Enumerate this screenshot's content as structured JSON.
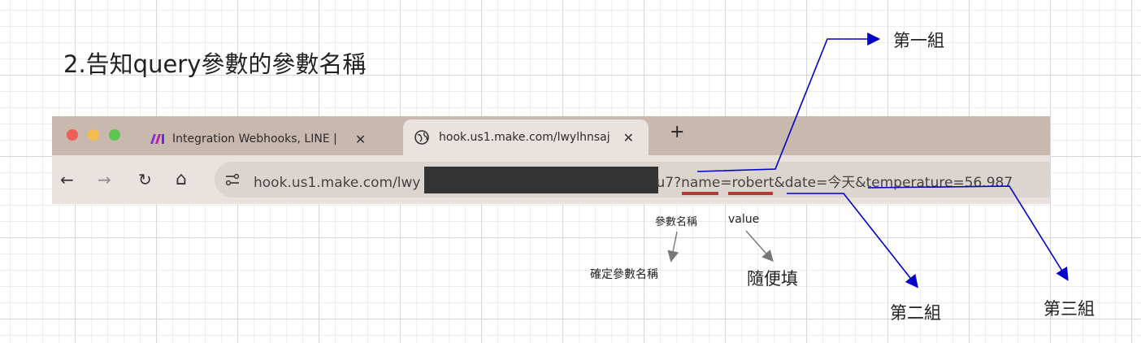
{
  "heading": "2.告知query參數的參數名稱",
  "colors": {
    "tab_bar": "#c9b8ae",
    "toolbar": "#e9e2de",
    "annotation_arrow": "#0000c8",
    "underline": "#b23a36",
    "redaction": "#333333"
  },
  "browser": {
    "tabs": [
      {
        "label": "Integration Webhooks, LINE |",
        "icon": "make-logo-icon",
        "close": "✕"
      },
      {
        "label": "hook.us1.make.com/lwylhnsaj",
        "icon": "globe-icon",
        "close": "✕",
        "active": true
      }
    ],
    "new_tab": "+",
    "nav": {
      "back": "←",
      "forward": "→",
      "reload": "↻",
      "home": "⌂"
    },
    "url": {
      "prefix": "hook.us1.make.com/lwy",
      "suffix": "u7?",
      "param1_name": "name",
      "param1_value": "=robert",
      "param2": "&date=今天&",
      "param3": "temperature=56.987"
    }
  },
  "annotations": {
    "group1": "第一組",
    "group2": "第二組",
    "group3": "第三組",
    "param_name": "參數名稱",
    "value": "value",
    "param_name_confirm": "確定參數名稱",
    "value_any": "隨便填"
  }
}
